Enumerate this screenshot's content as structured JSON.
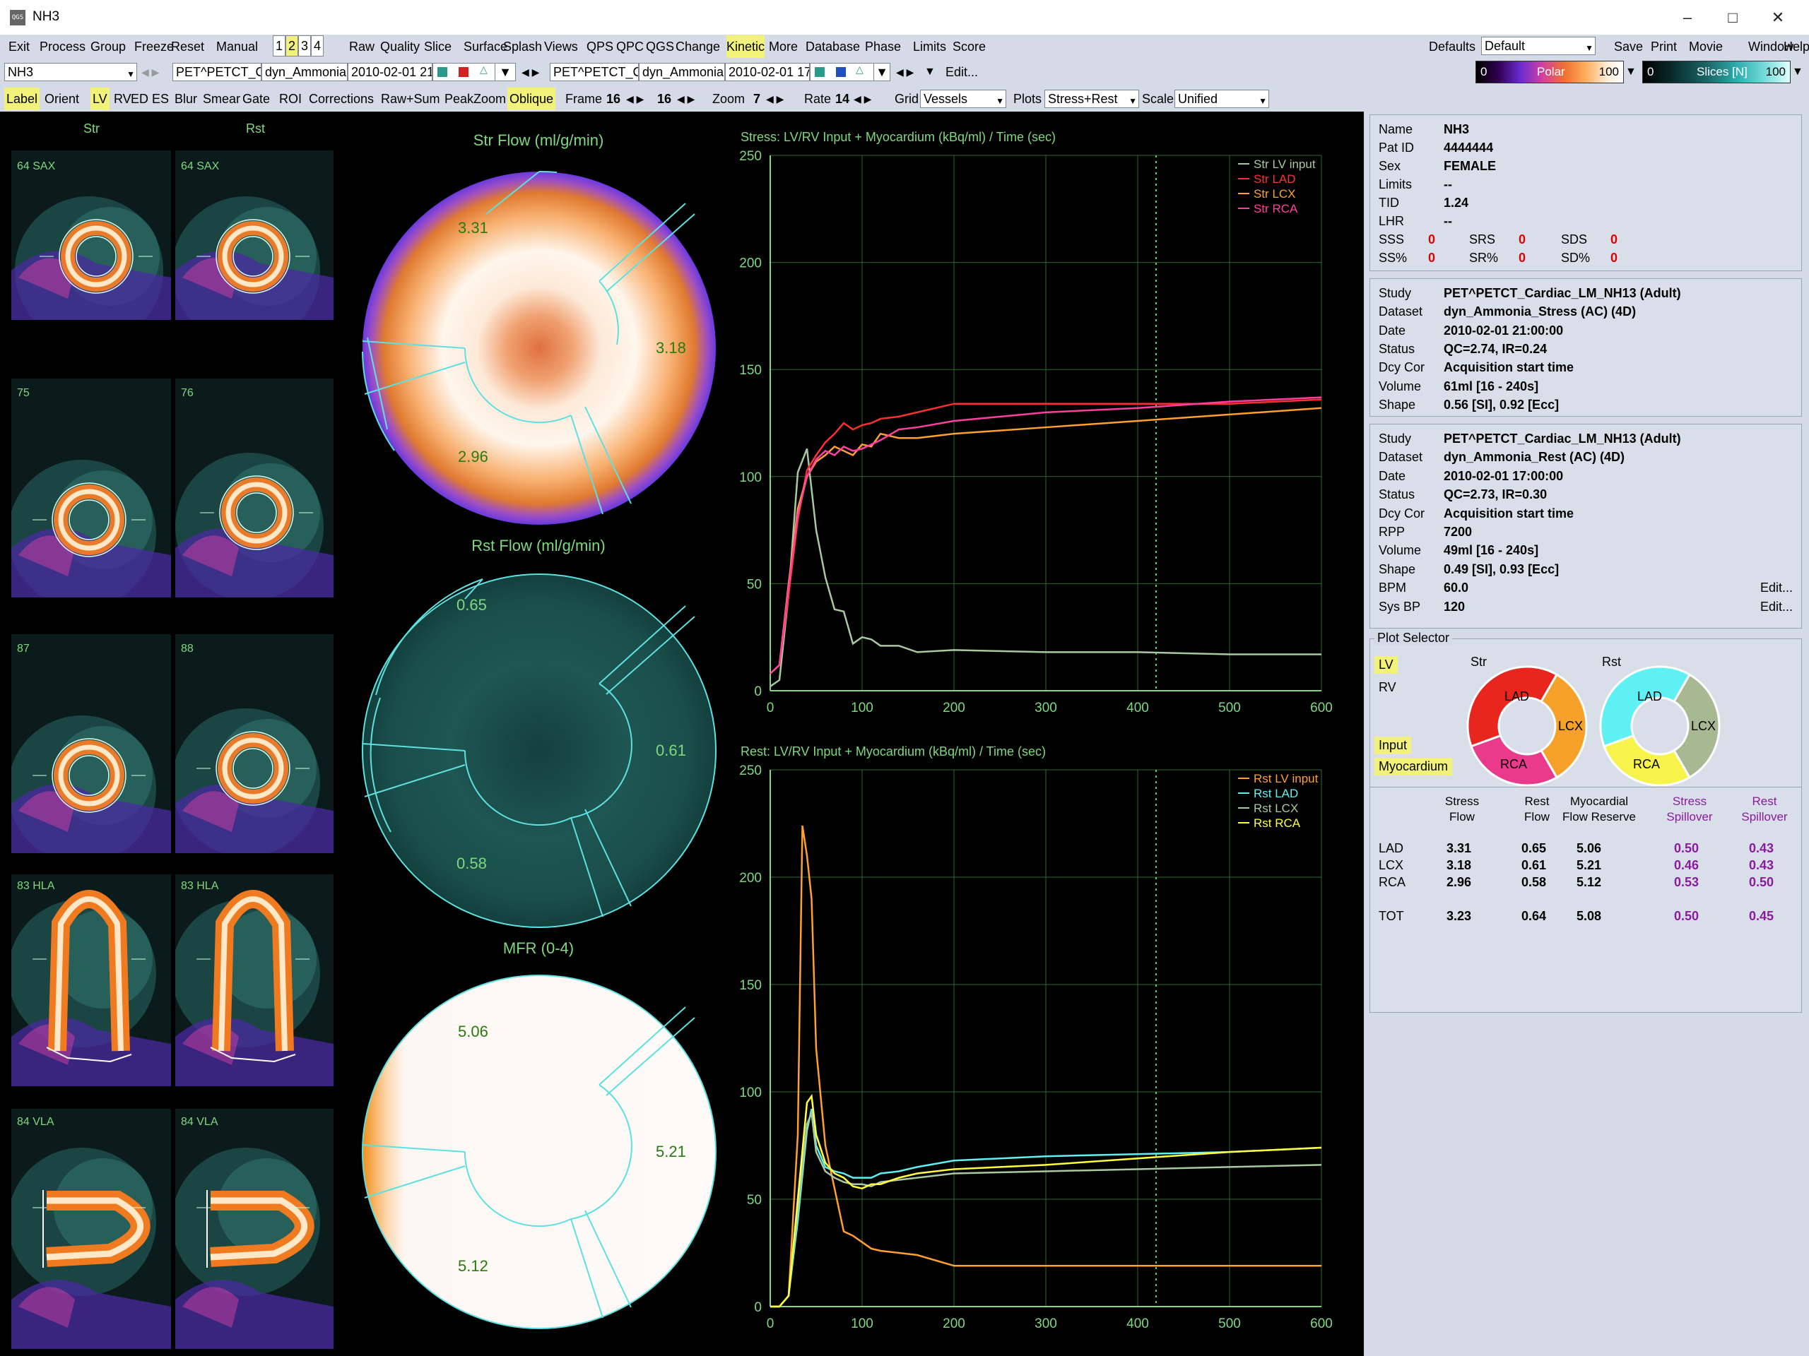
{
  "window": {
    "title": "NH3",
    "icon": "QGS"
  },
  "menubar": [
    "Exit",
    "Process",
    "Group",
    "Freeze",
    "Reset",
    "Manual",
    "1",
    "2",
    "3",
    "4",
    "Raw",
    "Quality",
    "Slice",
    "Surface",
    "Splash",
    "Views",
    "QPS",
    "QPC",
    "QGS",
    "Change",
    "Kinetic",
    "More",
    "Database",
    "Phase",
    "Limits",
    "Score"
  ],
  "menubar_right": {
    "defaults_label": "Defaults",
    "defaults_value": "Default",
    "items": [
      "Save",
      "Print",
      "Movie",
      "Window",
      "Help"
    ]
  },
  "toolbar2": {
    "patient": "NH3",
    "stress_study": "PET^PETCT_C",
    "stress_dataset": "dyn_Ammonia",
    "stress_date": "2010-02-01 21",
    "rest_study": "PET^PETCT_C",
    "rest_dataset": "dyn_Ammonia",
    "rest_date": "2010-02-01 17",
    "edit": "Edit...",
    "polar_bar": {
      "min": "0",
      "label": "Polar",
      "max": "100"
    },
    "slices_bar": {
      "min": "0",
      "label": "Slices [N]",
      "max": "100"
    }
  },
  "toolbar3": {
    "items": [
      "Label",
      "Orient",
      "LV",
      "RV",
      "ED",
      "ES",
      "Blur",
      "Smear",
      "Gate",
      "ROI",
      "Corrections",
      "Raw+Sum",
      "PeakZoom",
      "Oblique"
    ],
    "frame_label": "Frame",
    "frame1": "16",
    "frame2": "16",
    "zoom_label": "Zoom",
    "zoom": "7",
    "rate_label": "Rate",
    "rate": "14",
    "grid_label": "Grid",
    "grid_value": "Vessels",
    "plots_label": "Plots",
    "plots_value": "Stress+Rest",
    "scale_label": "Scale",
    "scale_value": "Unified"
  },
  "slices": {
    "str_header": "Str",
    "rst_header": "Rst",
    "labels": [
      [
        "64 SAX",
        "64 SAX"
      ],
      [
        "75",
        "76"
      ],
      [
        "87",
        "88"
      ],
      [
        "83 HLA",
        "83 HLA"
      ],
      [
        "84 VLA",
        "84 VLA"
      ]
    ]
  },
  "polar": [
    {
      "title": "Str Flow (ml/g/min)",
      "lad": "3.31",
      "lcx": "3.18",
      "rca": "2.96"
    },
    {
      "title": "Rst Flow (ml/g/min)",
      "lad": "0.65",
      "lcx": "0.61",
      "rca": "0.58"
    },
    {
      "title": "MFR (0-4)",
      "lad": "5.06",
      "lcx": "5.21",
      "rca": "5.12"
    }
  ],
  "chart_data": [
    {
      "type": "line",
      "title": "Stress: LV/RV Input + Myocardium (kBq/ml) / Time (sec)",
      "xlim": [
        0,
        600
      ],
      "ylim": [
        0,
        250
      ],
      "xticks": [
        0,
        100,
        200,
        300,
        400,
        500,
        600
      ],
      "yticks": [
        0,
        50,
        100,
        150,
        200,
        250
      ],
      "marker_x": 420,
      "legend": "top-right",
      "series": [
        {
          "name": "Str LV input",
          "color": "#a8c8a0",
          "x": [
            0,
            10,
            20,
            30,
            40,
            50,
            60,
            70,
            80,
            90,
            100,
            110,
            120,
            140,
            160,
            200,
            300,
            400,
            500,
            600
          ],
          "y": [
            2,
            5,
            45,
            102,
            113,
            75,
            53,
            38,
            37,
            22,
            25,
            24,
            21,
            21,
            18,
            19,
            18,
            18,
            17,
            17
          ]
        },
        {
          "name": "Str LAD",
          "color": "#ff3030",
          "x": [
            0,
            10,
            20,
            30,
            40,
            50,
            60,
            70,
            80,
            90,
            100,
            110,
            120,
            140,
            160,
            200,
            300,
            400,
            500,
            600
          ],
          "y": [
            8,
            12,
            45,
            80,
            103,
            110,
            116,
            120,
            125,
            122,
            124,
            125,
            127,
            128,
            130,
            134,
            134,
            134,
            134,
            136
          ]
        },
        {
          "name": "Str LCX",
          "color": "#ffa030",
          "x": [
            0,
            10,
            20,
            30,
            40,
            50,
            60,
            70,
            80,
            90,
            100,
            110,
            120,
            140,
            160,
            200,
            300,
            400,
            500,
            600
          ],
          "y": [
            8,
            12,
            50,
            85,
            100,
            107,
            110,
            114,
            112,
            110,
            115,
            114,
            120,
            118,
            118,
            120,
            123,
            126,
            129,
            132
          ]
        },
        {
          "name": "Str RCA",
          "color": "#ff40a0",
          "x": [
            0,
            10,
            20,
            30,
            40,
            50,
            60,
            70,
            80,
            90,
            100,
            110,
            120,
            140,
            160,
            200,
            300,
            400,
            500,
            600
          ],
          "y": [
            8,
            12,
            48,
            82,
            100,
            108,
            112,
            110,
            114,
            112,
            113,
            115,
            117,
            122,
            123,
            126,
            130,
            132,
            135,
            137
          ]
        }
      ]
    },
    {
      "type": "line",
      "title": "Rest: LV/RV Input + Myocardium (kBq/ml) / Time (sec)",
      "xlim": [
        0,
        600
      ],
      "ylim": [
        0,
        250
      ],
      "xticks": [
        0,
        100,
        200,
        300,
        400,
        500,
        600
      ],
      "yticks": [
        0,
        50,
        100,
        150,
        200,
        250
      ],
      "marker_x": 420,
      "legend": "top-right",
      "series": [
        {
          "name": "Rst LV input",
          "color": "#ffa030",
          "x": [
            0,
            10,
            20,
            30,
            35,
            40,
            45,
            50,
            60,
            70,
            80,
            90,
            100,
            110,
            120,
            140,
            160,
            200,
            300,
            400,
            500,
            600
          ],
          "y": [
            0,
            0,
            5,
            80,
            224,
            210,
            190,
            120,
            75,
            55,
            35,
            33,
            30,
            27,
            26,
            25,
            24,
            19,
            19,
            19,
            19,
            19
          ]
        },
        {
          "name": "Rst LAD",
          "color": "#60f0f0",
          "x": [
            0,
            10,
            20,
            30,
            40,
            45,
            50,
            60,
            70,
            80,
            90,
            100,
            110,
            120,
            140,
            160,
            200,
            300,
            400,
            500,
            600
          ],
          "y": [
            0,
            0,
            5,
            40,
            82,
            92,
            75,
            65,
            63,
            62,
            60,
            60,
            60,
            62,
            63,
            65,
            68,
            70,
            71,
            72,
            74
          ]
        },
        {
          "name": "Rst LCX",
          "color": "#a8c8a0",
          "x": [
            0,
            10,
            20,
            30,
            40,
            45,
            50,
            60,
            70,
            80,
            90,
            100,
            110,
            120,
            140,
            160,
            200,
            300,
            400,
            500,
            600
          ],
          "y": [
            0,
            0,
            5,
            45,
            85,
            90,
            72,
            63,
            60,
            58,
            57,
            57,
            56,
            58,
            59,
            60,
            62,
            63,
            64,
            65,
            66
          ]
        },
        {
          "name": "Rst RCA",
          "color": "#ffff40",
          "x": [
            0,
            10,
            20,
            30,
            40,
            45,
            50,
            60,
            70,
            80,
            90,
            100,
            110,
            120,
            140,
            160,
            200,
            300,
            400,
            500,
            600
          ],
          "y": [
            0,
            0,
            5,
            50,
            95,
            98,
            80,
            67,
            62,
            60,
            56,
            55,
            57,
            57,
            60,
            62,
            64,
            66,
            69,
            72,
            74
          ]
        }
      ]
    }
  ],
  "patient": {
    "rows": [
      [
        "Name",
        "NH3"
      ],
      [
        "Pat ID",
        "4444444"
      ],
      [
        "Sex",
        "FEMALE"
      ],
      [
        "Limits",
        "--"
      ],
      [
        "TID",
        "1.24"
      ],
      [
        "LHR",
        "--"
      ]
    ],
    "scores": [
      [
        "SSS",
        "0"
      ],
      [
        "SRS",
        "0"
      ],
      [
        "SDS",
        "0"
      ]
    ],
    "scores_pct": [
      [
        "SS%",
        "0"
      ],
      [
        "SR%",
        "0"
      ],
      [
        "SD%",
        "0"
      ]
    ]
  },
  "stress_study": {
    "rows": [
      [
        "Study",
        "PET^PETCT_Cardiac_LM_NH13 (Adult)"
      ],
      [
        "Dataset",
        "dyn_Ammonia_Stress (AC) (4D)"
      ],
      [
        "Date",
        "2010-02-01 21:00:00"
      ],
      [
        "Status",
        "QC=2.74, IR=0.24"
      ],
      [
        "Dcy Cor",
        "Acquisition start time"
      ],
      [
        "Volume",
        "61ml [16 - 240s]"
      ],
      [
        "Shape",
        "0.56 [SI],  0.92 [Ecc]"
      ]
    ]
  },
  "rest_study": {
    "rows": [
      [
        "Study",
        "PET^PETCT_Cardiac_LM_NH13 (Adult)"
      ],
      [
        "Dataset",
        "dyn_Ammonia_Rest (AC) (4D)"
      ],
      [
        "Date",
        "2010-02-01 17:00:00"
      ],
      [
        "Status",
        "QC=2.73, IR=0.30"
      ],
      [
        "Dcy Cor",
        "Acquisition start time"
      ],
      [
        "RPP",
        "7200"
      ],
      [
        "Volume",
        "49ml [16 - 240s]"
      ],
      [
        "Shape",
        "0.49 [SI],  0.93 [Ecc]"
      ],
      [
        "BPM",
        "60.0"
      ],
      [
        "Sys BP",
        "120"
      ]
    ],
    "edit1": "Edit...",
    "edit2": "Edit..."
  },
  "plot_selector": {
    "title": "Plot Selector",
    "lv": "LV",
    "rv": "RV",
    "input": "Input",
    "myocardium": "Myocardium",
    "str": "Str",
    "rst": "Rst",
    "lad": "LAD",
    "lcx": "LCX",
    "rca": "RCA",
    "str_colors": {
      "lad": "#e8261e",
      "lcx": "#f5a12a",
      "rca": "#e93a8c"
    },
    "rst_colors": {
      "lad": "#5ff0f4",
      "lcx": "#a7b893",
      "rca": "#f8f34a"
    }
  },
  "flow_table": {
    "headers": [
      [
        "",
        ""
      ],
      [
        "Stress",
        "Flow"
      ],
      [
        "Rest",
        "Flow"
      ],
      [
        "Myocardial",
        "Flow Reserve"
      ],
      [
        "Stress",
        "Spillover"
      ],
      [
        "Rest",
        "Spillover"
      ]
    ],
    "rows": [
      [
        "LAD",
        "3.31",
        "0.65",
        "5.06",
        "0.50",
        "0.43"
      ],
      [
        "LCX",
        "3.18",
        "0.61",
        "5.21",
        "0.46",
        "0.43"
      ],
      [
        "RCA",
        "2.96",
        "0.58",
        "5.12",
        "0.53",
        "0.50"
      ]
    ],
    "total": [
      "TOT",
      "3.23",
      "0.64",
      "5.08",
      "0.50",
      "0.45"
    ]
  }
}
